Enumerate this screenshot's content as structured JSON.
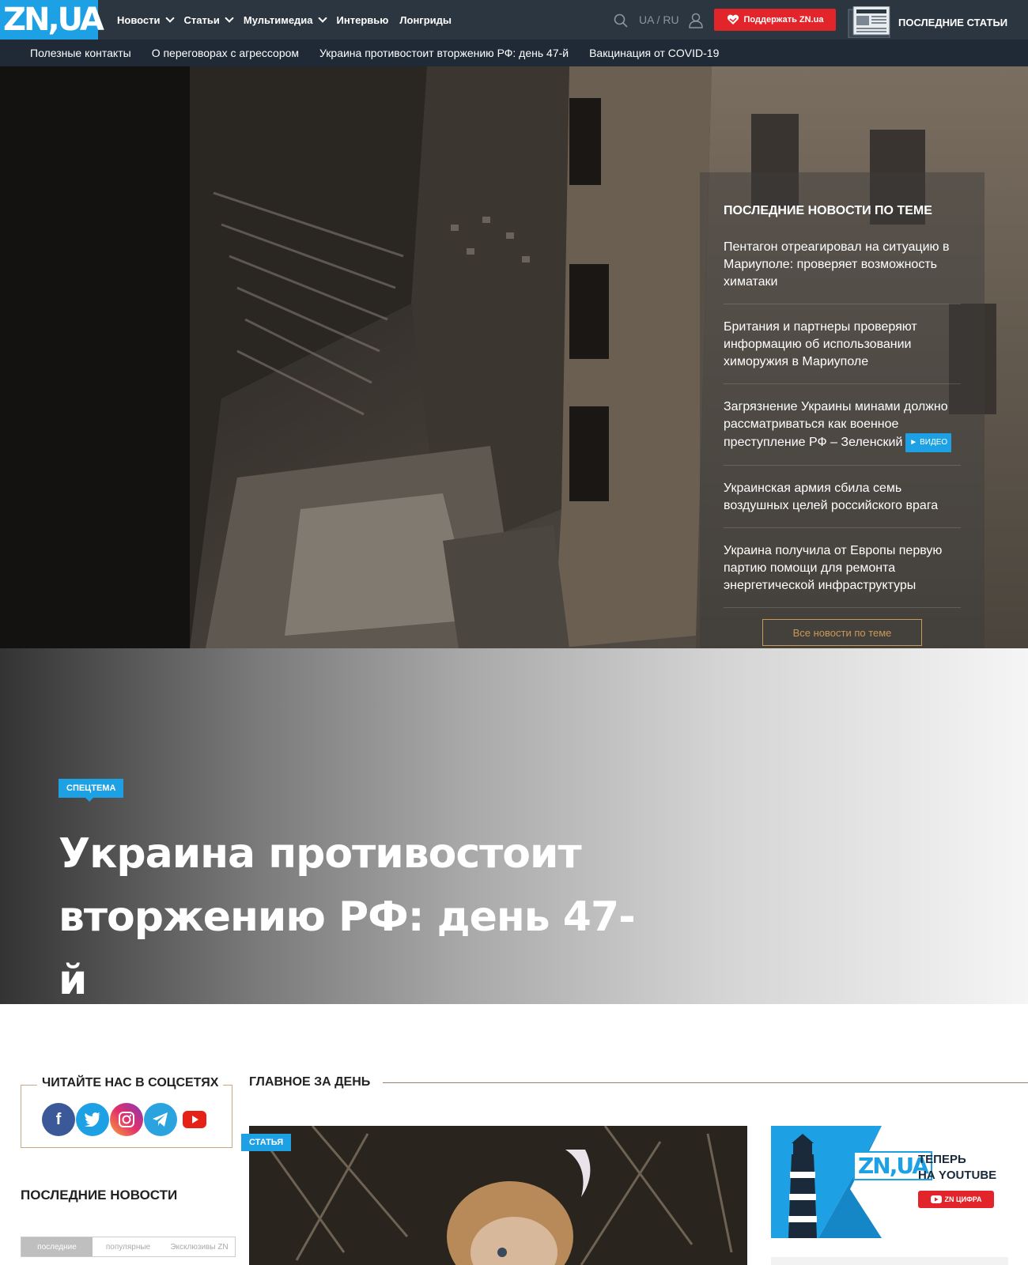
{
  "header": {
    "logo": "ZN,UA",
    "nav": [
      "Новости",
      "Статьи",
      "Мультимедиа",
      "Интервью",
      "Лонгриды"
    ],
    "lang_ua": "UA",
    "lang_sep": "/",
    "lang_ru": "RU",
    "support_label": "Поддержать ZN.ua",
    "latest_articles_label": "ПОСЛЕДНИЕ СТАТЬИ"
  },
  "subnav": [
    "Полезные контакты",
    "О переговорах с агрессором",
    "Украина противостоит вторжению РФ: день 47-й",
    "Вакцинация от COVID-19"
  ],
  "topic": {
    "title": "ПОСЛЕДНИЕ НОВОСТИ ПО ТЕМЕ",
    "items": [
      "Пентагон отреагировал на ситуацию в Мариуполе: проверяет возможность химатаки",
      "Британия и партнеры проверяют информацию об использовании химоружия в Мариуполе",
      "Загрязнение Украины минами должно рассматриваться как военное преступление РФ – Зеленский",
      "Украинская армия сбила семь воздушных целей российского врага",
      "Украина получила от Европы первую партию помощи для ремонта энергетической инфраструктуры"
    ],
    "video_badge": "► ВИДЕО",
    "all_button": "Все новости по теме"
  },
  "banner": {
    "badge": "СПЕЦТЕМА",
    "title": "Украина противостоит вторжению РФ: день 47-й"
  },
  "social": {
    "title": "ЧИТАЙТЕ НАС В СОЦСЕТЯХ",
    "networks": [
      "facebook",
      "twitter",
      "instagram",
      "telegram",
      "youtube"
    ]
  },
  "latest_news": {
    "title": "ПОСЛЕДНИЕ НОВОСТИ",
    "tabs": [
      "последние",
      "популярные",
      "Эксклюзивы ZN"
    ]
  },
  "main_day": {
    "title": "ГЛАВНОЕ ЗА ДЕНЬ",
    "article_badge": "СТАТЬЯ"
  },
  "youtube_promo": {
    "logo": "ZN,UA",
    "line1": "ТЕПЕРЬ",
    "line2": "НА YOUTUBE",
    "channel": "ZN ЦИФРА"
  },
  "colors": {
    "brand_blue": "#1da1e4",
    "topbar": "#2c3640",
    "support_red": "#e2252b",
    "gold": "#c79a56"
  }
}
